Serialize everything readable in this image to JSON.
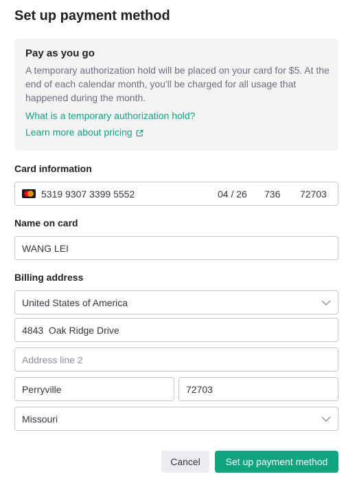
{
  "header": {
    "title": "Set up payment method"
  },
  "info": {
    "title": "Pay as you go",
    "description": "A temporary authorization hold will be placed on your card for $5. At the end of each calendar month, you'll be charged for all usage that happened during the month.",
    "link_hold": "What is a temporary authorization hold?",
    "link_pricing": "Learn more about pricing"
  },
  "card": {
    "label": "Card information",
    "brand_icon": "mastercard-icon",
    "number": "5319 9307 3399 5552",
    "expiry": "04 / 26",
    "cvc": "736",
    "zip": "72703"
  },
  "name": {
    "label": "Name on card",
    "value": "WANG LEI"
  },
  "billing": {
    "label": "Billing address",
    "country": "United States of America",
    "line1": "4843  Oak Ridge Drive",
    "line2_placeholder": "Address line 2",
    "line2": "",
    "city": "Perryville",
    "postal": "72703",
    "state": "Missouri"
  },
  "actions": {
    "cancel": "Cancel",
    "submit": "Set up payment method"
  },
  "colors": {
    "accent": "#10a37f",
    "info_bg": "#f4f4f5",
    "border": "#c5c5d2"
  }
}
